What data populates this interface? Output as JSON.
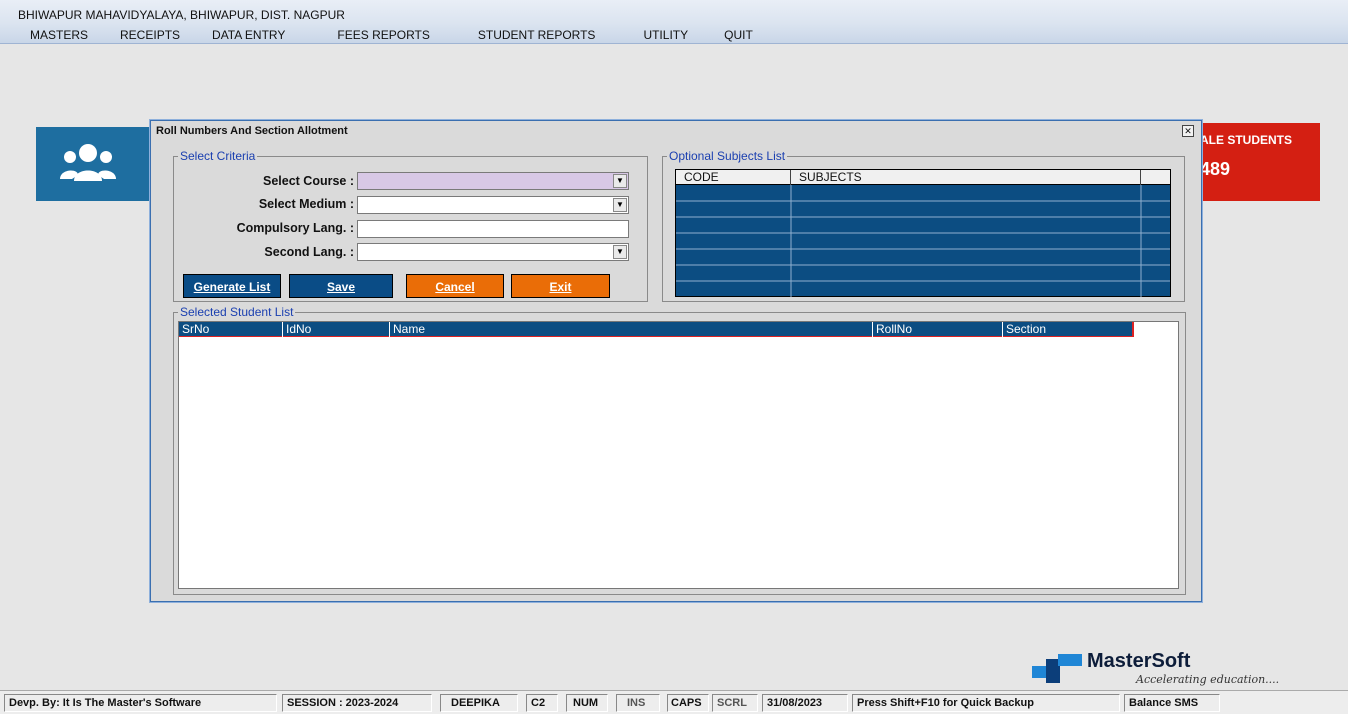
{
  "app": {
    "title": "BHIWAPUR MAHAVIDYALAYA, BHIWAPUR, DIST. NAGPUR",
    "menu": [
      "MASTERS",
      "RECEIPTS",
      "DATA ENTRY",
      "FEES REPORTS",
      "STUDENT REPORTS",
      "UTILITY",
      "QUIT"
    ]
  },
  "dashboard": {
    "right_tile_title": "ALE STUDENTS",
    "right_tile_count": "489",
    "icon": "users-icon"
  },
  "dialog": {
    "title": "Roll Numbers And Section Allotment",
    "close_label": "✕",
    "criteria": {
      "legend": "Select Criteria",
      "course_label": "Select Course :",
      "course_value": "",
      "medium_label": "Select Medium :",
      "medium_value": "",
      "comp_lang_label": "Compulsory Lang. :",
      "comp_lang_value": "",
      "second_lang_label": "Second Lang. :",
      "second_lang_value": ""
    },
    "buttons": {
      "generate": "Generate List",
      "save": "Save",
      "cancel": "Cancel",
      "exit": "Exit"
    },
    "optional": {
      "legend": "Optional Subjects List",
      "columns": [
        "CODE",
        "SUBJECTS"
      ]
    },
    "students": {
      "legend": "Selected Student List",
      "columns": [
        "SrNo",
        "IdNo",
        "Name",
        "RollNo",
        "Section"
      ]
    }
  },
  "logo": {
    "name": "MasterSoft",
    "tagline": "Accelerating education...."
  },
  "status": {
    "dev": "Devp. By: It Is The Master's Software",
    "session": "SESSION : 2023-2024",
    "user": "DEEPIKA",
    "code": "C2",
    "num": "NUM",
    "ins": "INS",
    "caps": "CAPS",
    "scrl": "SCRL",
    "date": "31/08/2023",
    "backup_hint": "Press Shift+F10 for Quick Backup",
    "sms": "Balance SMS"
  },
  "colors": {
    "dialog_bg": "#dadada",
    "grid_blue": "#0c4d82",
    "button_blue": "#0a4c86",
    "button_orange": "#ea6d07",
    "tile_blue": "#1e6ea0",
    "tile_red": "#d41f12",
    "course_field_bg": "#d8c8e6"
  }
}
